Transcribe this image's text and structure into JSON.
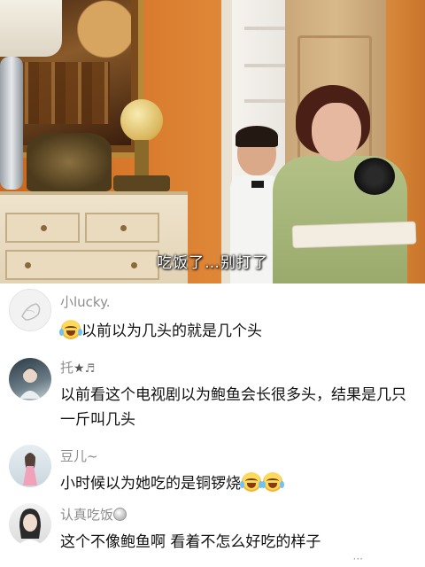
{
  "video": {
    "subtitle": "吃饭了…别打了"
  },
  "comments": [
    {
      "username": "小lucky.",
      "text": "以前以为几头的就是几个头",
      "leading_emoji": "crying-laughing-emoji"
    },
    {
      "username": "托",
      "username_icons": [
        "star-icon",
        "music-note-icon"
      ],
      "star_symbol": "★",
      "note_symbol": "♬",
      "text": "以前看这个电视剧以为鲍鱼会长很多头，结果是几只一斤叫几头"
    },
    {
      "username": "豆儿~",
      "text": "小时候以为她吃的是铜锣烧",
      "trailing_emojis": [
        "crying-laughing-emoji",
        "crying-laughing-emoji"
      ]
    },
    {
      "username": "认真吃饭",
      "username_icons": [
        "badge-icon"
      ],
      "text": "这个不像鲍鱼啊 看着不怎么好吃的样子"
    }
  ]
}
